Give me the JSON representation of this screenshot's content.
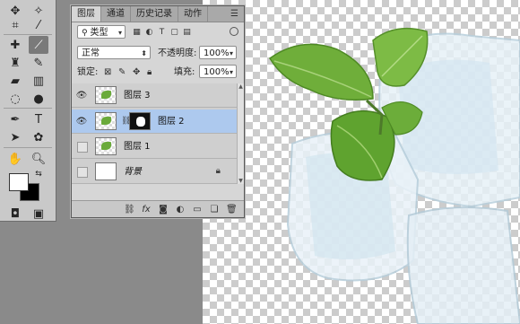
{
  "tabs": [
    "图层",
    "通道",
    "历史记录",
    "动作"
  ],
  "filter": {
    "label": "类型"
  },
  "blend_mode": "正常",
  "opacity": {
    "label": "不透明度:",
    "value": "100%"
  },
  "lock": {
    "label": "锁定:"
  },
  "fill": {
    "label": "填充:",
    "value": "100%"
  },
  "layers": [
    {
      "name": "图层 3",
      "visible": true,
      "selected": false
    },
    {
      "name": "图层 2",
      "visible": true,
      "selected": true
    },
    {
      "name": "图层 1",
      "visible": false,
      "selected": false
    },
    {
      "name": "背景",
      "visible": false,
      "selected": false,
      "locked": true
    }
  ],
  "footer_icons": [
    "link-icon",
    "fx-icon",
    "mask-icon",
    "adjustment-icon",
    "folder-icon",
    "new-layer-icon",
    "trash-icon"
  ],
  "footer_text": {
    "fx": "fx"
  },
  "colors": {
    "selection": "#adc9ee",
    "mint": "#6aaa3a",
    "panel": "#d6d6d6"
  }
}
